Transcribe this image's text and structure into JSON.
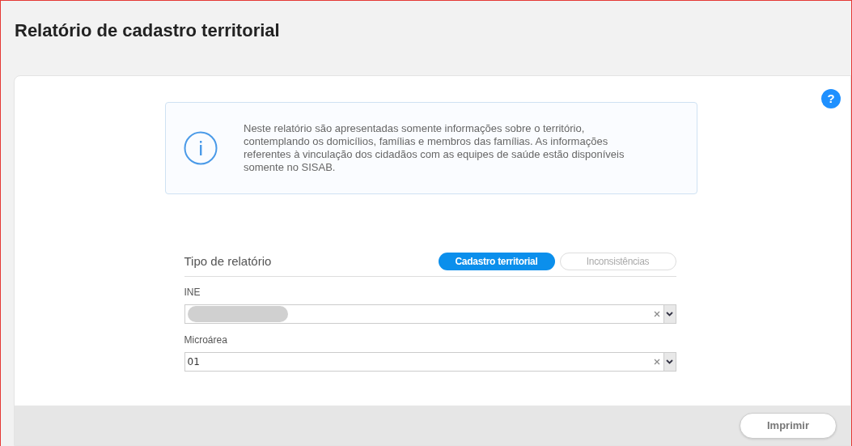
{
  "page_title": "Relatório de cadastro territorial",
  "help_button": {
    "label": "?"
  },
  "info_box": {
    "text": "Neste relatório são apresentadas somente informações sobre o território, contemplando os domicílios, famílias e membros das famílias. As informações referentes à vinculação dos cidadãos com as equipes de saúde estão disponíveis somente no SISAB."
  },
  "report_type": {
    "label": "Tipo de relatório",
    "options": [
      {
        "label": "Cadastro territorial",
        "selected": true
      },
      {
        "label": "Inconsistências",
        "selected": false
      }
    ]
  },
  "fields": [
    {
      "label": "INE",
      "redacted": true
    },
    {
      "label": "Microárea",
      "value": "01",
      "redacted": false
    }
  ],
  "buttons": [
    "Imprimir"
  ]
}
